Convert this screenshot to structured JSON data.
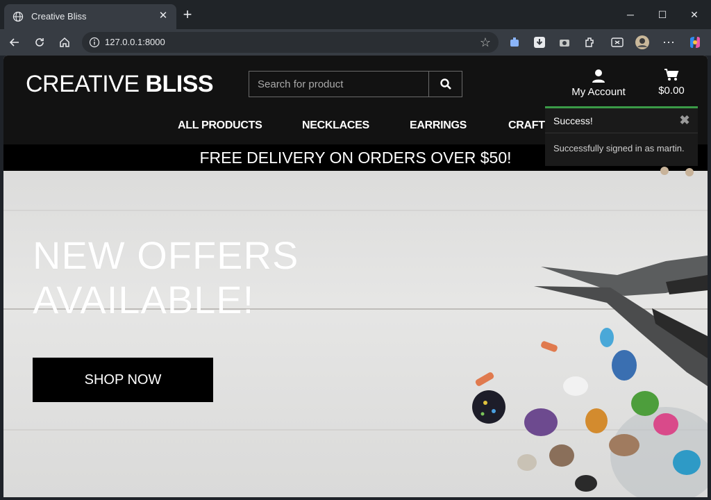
{
  "browser": {
    "tab_title": "Creative Bliss",
    "tab_close": "✕",
    "new_tab": "+",
    "url": "127.0.0.1:8000",
    "window": {
      "minimize": "─",
      "maximize": "☐",
      "close": "✕"
    },
    "accent": "#373c43"
  },
  "site": {
    "logo_light": "CREATIVE ",
    "logo_bold": "BLISS",
    "search_placeholder": "Search for product",
    "account_label": "My Account",
    "cart_total": "$0.00",
    "nav": [
      "ALL PRODUCTS",
      "NECKLACES",
      "EARRINGS",
      "CRAFTS"
    ],
    "banner": "FREE DELIVERY ON ORDERS OVER $50!",
    "hero_line1": "NEW OFFERS",
    "hero_line2": "AVAILABLE!",
    "cta": "SHOP NOW"
  },
  "toast": {
    "title": "Success!",
    "message": "Successfully signed in as martin.",
    "accent": "#3a9a47"
  }
}
